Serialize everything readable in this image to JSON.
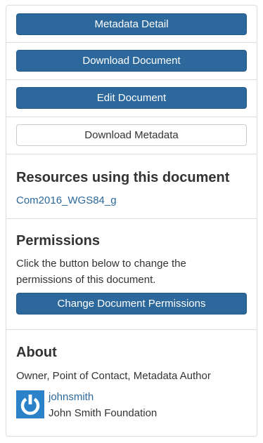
{
  "actions": {
    "metadata_detail": "Metadata Detail",
    "download_document": "Download Document",
    "edit_document": "Edit Document",
    "download_metadata": "Download Metadata"
  },
  "resources": {
    "heading": "Resources using this document",
    "items": [
      {
        "label": "Com2016_WGS84_g"
      }
    ]
  },
  "permissions": {
    "heading": "Permissions",
    "description": "Click the button below to change the permissions of this document.",
    "button_label": "Change Document Permissions"
  },
  "about": {
    "heading": "About",
    "roles": "Owner, Point of Contact, Metadata Author",
    "user": {
      "username": "johnsmith",
      "organization": "John Smith Foundation",
      "avatar_icon": "power-icon",
      "avatar_color": "#2c82c9"
    }
  },
  "colors": {
    "primary": "#2c689c",
    "link": "#2c689c",
    "border": "#dddddd"
  }
}
